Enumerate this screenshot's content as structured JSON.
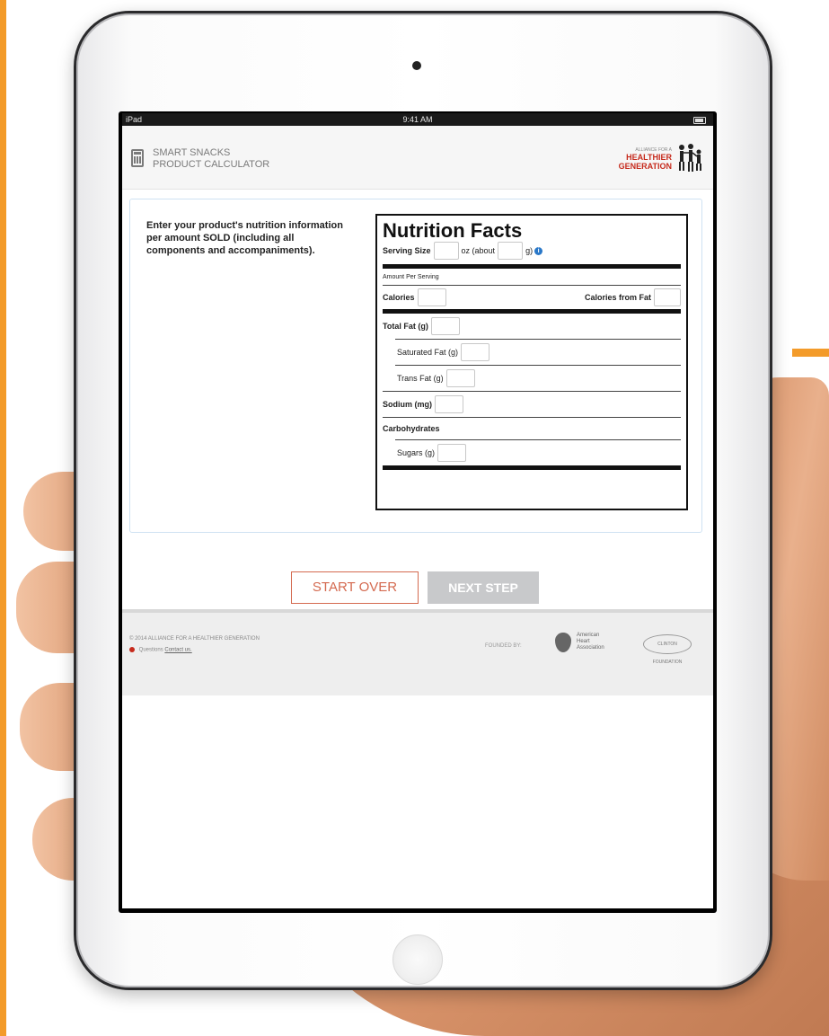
{
  "status_bar": {
    "device": "iPad",
    "time": "9:41 AM"
  },
  "header": {
    "title_line1": "SMART SNACKS",
    "title_line2": "PRODUCT CALCULATOR",
    "logo_top": "ALLIANCE FOR A",
    "logo_line1": "HEALTHIER",
    "logo_line2": "GENERATION"
  },
  "instructions": "Enter your product's nutrition information per amount SOLD (including all components and accompaniments).",
  "nutrition_facts": {
    "title": "Nutrition Facts",
    "serving_size_label": "Serving Size",
    "serving_oz_label": "oz (about",
    "serving_g_label": "g)",
    "amount_per_serving": "Amount Per Serving",
    "calories_label": "Calories",
    "calories_from_fat_label": "Calories from Fat",
    "total_fat_label": "Total Fat (g)",
    "saturated_fat_label": "Saturated Fat (g)",
    "trans_fat_label": "Trans Fat (g)",
    "sodium_label": "Sodium (mg)",
    "carbohydrates_label": "Carbohydrates",
    "sugars_label": "Sugars (g)"
  },
  "buttons": {
    "start_over": "START OVER",
    "next_step": "NEXT STEP"
  },
  "footer": {
    "copyright": "© 2014 ALLIANCE FOR A HEALTHIER GENERATION",
    "questions_label": "Questions",
    "contact_link": "Contact us.",
    "founded_by": "FOUNDED BY:",
    "aha_line1": "American",
    "aha_line2": "Heart",
    "aha_line3": "Association",
    "clinton_logo": "CLINTON FOUNDATION"
  },
  "colors": {
    "accent_orange": "#f39b2a",
    "brand_red": "#c62a1c",
    "start_over": "#d46a50",
    "next_step_disabled": "#c8c9cb"
  }
}
